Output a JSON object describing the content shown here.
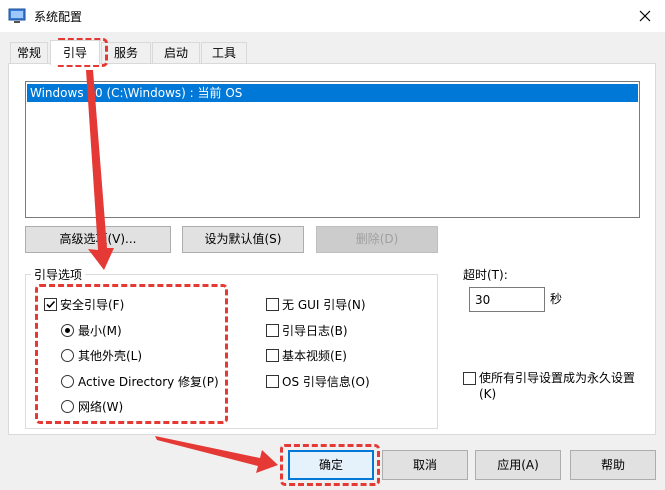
{
  "window": {
    "title": "系统配置",
    "icon": "system-config-icon",
    "close_icon": "close-icon"
  },
  "tabs": [
    {
      "label": "常规",
      "active": false
    },
    {
      "label": "引导",
      "active": true
    },
    {
      "label": "服务",
      "active": false
    },
    {
      "label": "启动",
      "active": false
    },
    {
      "label": "工具",
      "active": false
    }
  ],
  "os_list": {
    "items": [
      {
        "label": "Windows 10 (C:\\Windows) : 当前 OS",
        "selected": true
      }
    ]
  },
  "os_buttons": {
    "advanced": "高级选项(V)...",
    "set_default": "设为默认值(S)",
    "delete": "删除(D)"
  },
  "boot_options": {
    "group_label": "引导选项",
    "safe_boot": {
      "label": "安全引导(F)",
      "checked": true
    },
    "radios": [
      {
        "label": "最小(M)",
        "checked": true
      },
      {
        "label": "其他外壳(L)",
        "checked": false
      },
      {
        "label": "Active Directory 修复(P)",
        "checked": false
      },
      {
        "label": "网络(W)",
        "checked": false
      }
    ],
    "right_checks": [
      {
        "label": "无 GUI 引导(N)",
        "checked": false
      },
      {
        "label": "引导日志(B)",
        "checked": false
      },
      {
        "label": "基本视频(E)",
        "checked": false
      },
      {
        "label": "OS 引导信息(O)",
        "checked": false
      }
    ]
  },
  "timeout": {
    "label": "超时(T):",
    "value": "30",
    "unit": "秒"
  },
  "permanent": {
    "line1": "使所有引导设置成为永久设置",
    "line2": "(K)",
    "checked": false
  },
  "footer": {
    "ok": "确定",
    "cancel": "取消",
    "apply": "应用(A)",
    "help": "帮助"
  },
  "colors": {
    "selection": "#0078d7",
    "annotation": "#e53935"
  }
}
